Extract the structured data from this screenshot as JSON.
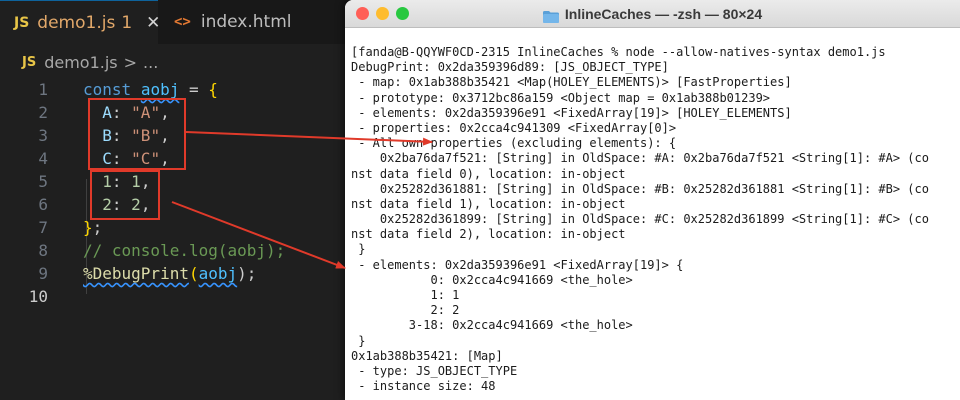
{
  "editor": {
    "tabs": [
      {
        "icon": "JS",
        "label": "demo1.js",
        "badge": "1",
        "close": "✕"
      },
      {
        "icon": "<>",
        "label": "index.html"
      }
    ],
    "breadcrumb": {
      "icon": "JS",
      "file": "demo1.js",
      "sep": ">",
      "more": "..."
    },
    "line_numbers": [
      "1",
      "2",
      "3",
      "4",
      "5",
      "6",
      "7",
      "8",
      "9",
      "10"
    ]
  },
  "code": {
    "l1": {
      "kw": "const",
      "var": "aobj",
      "op": " = ",
      "brace": "{"
    },
    "l2": {
      "key": "A",
      "colon": ": ",
      "val": "\"A\"",
      "comma": ","
    },
    "l3": {
      "key": "B",
      "colon": ": ",
      "val": "\"B\"",
      "comma": ","
    },
    "l4": {
      "key": "C",
      "colon": ": ",
      "val": "\"C\"",
      "comma": ","
    },
    "l5": {
      "key": "1",
      "colon": ": ",
      "val": "1",
      "comma": ","
    },
    "l6": {
      "key": "2",
      "colon": ": ",
      "val": "2",
      "comma": ","
    },
    "l7": {
      "brace": "}",
      "semi": ";"
    },
    "l8": {
      "comment": "// console.log(aobj);"
    },
    "l9": {
      "fn": "%DebugPrint",
      "open": "(",
      "arg": "aobj",
      "close": ");"
    }
  },
  "terminal": {
    "title": "InlineCaches — -zsh — 80×24",
    "lines": [
      "[fanda@B-QQYWF0CD-2315 InlineCaches % node --allow-natives-syntax demo1.js",
      "DebugPrint: 0x2da359396d89: [JS_OBJECT_TYPE]",
      " - map: 0x1ab388b35421 <Map(HOLEY_ELEMENTS)> [FastProperties]",
      " - prototype: 0x3712bc86a159 <Object map = 0x1ab388b01239>",
      " - elements: 0x2da359396e91 <FixedArray[19]> [HOLEY_ELEMENTS]",
      " - properties: 0x2cca4c941309 <FixedArray[0]>",
      " - All own properties (excluding elements): {",
      "    0x2ba76da7f521: [String] in OldSpace: #A: 0x2ba76da7f521 <String[1]: #A> (co",
      "nst data field 0), location: in-object",
      "    0x25282d361881: [String] in OldSpace: #B: 0x25282d361881 <String[1]: #B> (co",
      "nst data field 1), location: in-object",
      "    0x25282d361899: [String] in OldSpace: #C: 0x25282d361899 <String[1]: #C> (co",
      "nst data field 2), location: in-object",
      " }",
      " - elements: 0x2da359396e91 <FixedArray[19]> {",
      "           0: 0x2cca4c941669 <the_hole>",
      "           1: 1",
      "           2: 2",
      "        3-18: 0x2cca4c941669 <the_hole>",
      " }",
      "0x1ab388b35421: [Map]",
      " - type: JS_OBJECT_TYPE",
      " - instance size: 48"
    ]
  },
  "colors": {
    "annotation": "#e03a2a",
    "editor_bg": "#1f1f1f",
    "terminal_bg": "#ffffff"
  }
}
